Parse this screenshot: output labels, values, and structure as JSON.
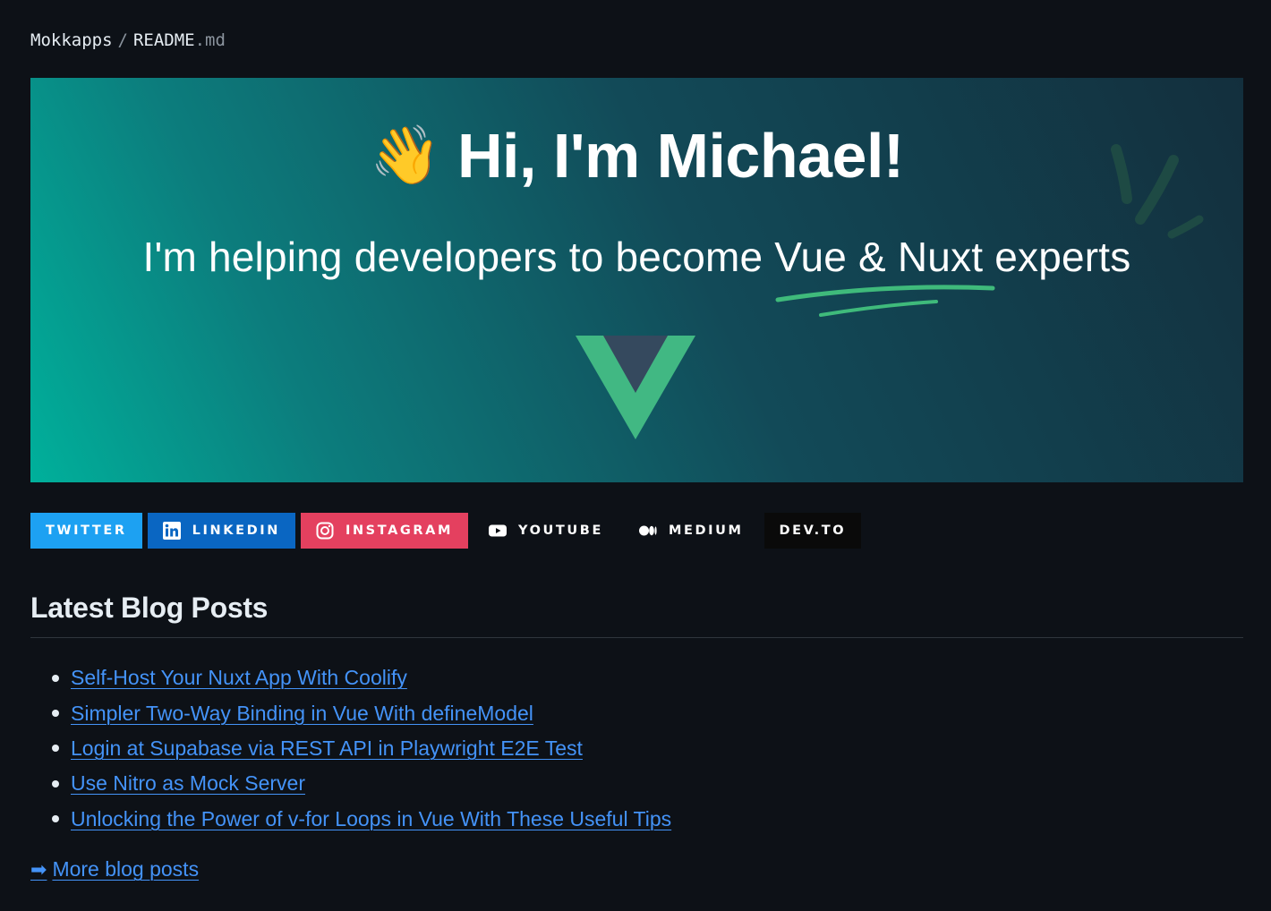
{
  "breadcrumb": {
    "owner": "Mokkapps",
    "separator": "/",
    "file": "README",
    "extension": ".md"
  },
  "banner": {
    "emoji": "👋",
    "title": "Hi, I'm Michael!",
    "subtitle": "I'm helping developers to become Vue & Nuxt experts",
    "logo": "vue-logo-icon"
  },
  "badges": [
    {
      "label": "TWITTER",
      "icon": "",
      "color": "#1da1f2"
    },
    {
      "label": "LINKEDIN",
      "icon": "linkedin-icon",
      "color": "#0a66c2"
    },
    {
      "label": "INSTAGRAM",
      "icon": "instagram-icon",
      "color": "#e4405f"
    },
    {
      "label": "YOUTUBE",
      "icon": "youtube-icon",
      "color": "#0d1117"
    },
    {
      "label": "MEDIUM",
      "icon": "medium-icon",
      "color": "#0d1117"
    },
    {
      "label": "DEV.TO",
      "icon": "",
      "color": "#0a0a0a"
    }
  ],
  "blog": {
    "heading": "Latest Blog Posts",
    "posts": [
      "Self-Host Your Nuxt App With Coolify",
      "Simpler Two-Way Binding in Vue With defineModel",
      "Login at Supabase via REST API in Playwright E2E Test",
      "Use Nitro as Mock Server",
      "Unlocking the Power of v-for Loops in Vue With These Useful Tips"
    ],
    "more_arrow": "➡",
    "more_label": "More blog posts"
  },
  "colors": {
    "background": "#0d1117",
    "link": "#4493f8",
    "text": "#e6edf3"
  }
}
